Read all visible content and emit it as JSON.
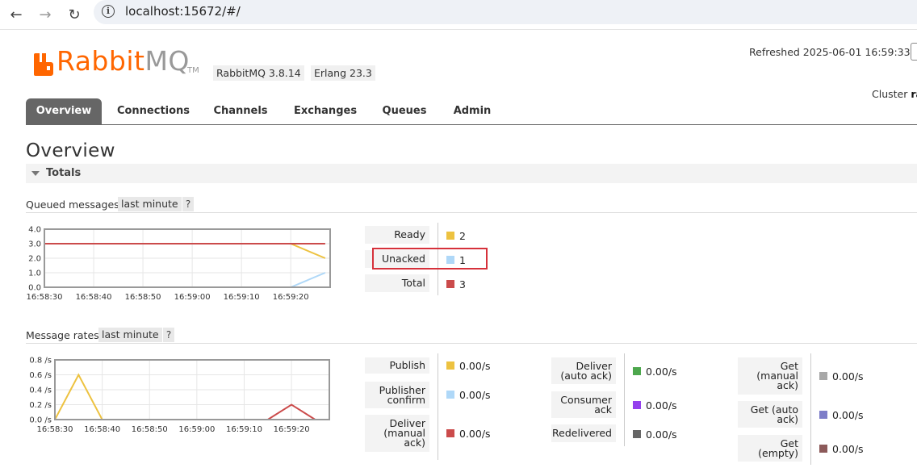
{
  "browser": {
    "url": "localhost:15672/#/",
    "back_icon": "arrow-left-icon",
    "forward_icon": "arrow-right-icon",
    "reload_icon": "reload-icon",
    "info_icon": "info-icon",
    "info_glyph": "i"
  },
  "header": {
    "logo_rabbit": "Rabbit",
    "logo_mq": "MQ",
    "logo_tm": "TM",
    "version_rabbitmq": "RabbitMQ 3.8.14",
    "version_erlang": "Erlang 23.3",
    "refreshed": "Refreshed 2025-06-01 16:59:33",
    "cluster_label": "Cluster",
    "cluster_value": "ra"
  },
  "tabs": [
    {
      "label": "Overview",
      "active": true
    },
    {
      "label": "Connections"
    },
    {
      "label": "Channels"
    },
    {
      "label": "Exchanges"
    },
    {
      "label": "Queues"
    },
    {
      "label": "Admin"
    }
  ],
  "page_title": "Overview",
  "totals_label": "Totals",
  "queued": {
    "label": "Queued messages",
    "range": "last minute",
    "help": "?",
    "rows": [
      {
        "label": "Ready",
        "value": "2",
        "color": "#edc240"
      },
      {
        "label": "Unacked",
        "value": "1",
        "color": "#afd8f8"
      },
      {
        "label": "Total",
        "value": "3",
        "color": "#cb4b4b"
      }
    ]
  },
  "rates": {
    "label": "Message rates",
    "range": "last minute",
    "help": "?",
    "col1": [
      {
        "label": "Publish",
        "value": "0.00/s",
        "color": "#edc240"
      },
      {
        "label": "Publisher confirm",
        "value": "0.00/s",
        "color": "#afd8f8"
      },
      {
        "label": "Deliver (manual ack)",
        "value": "0.00/s",
        "color": "#cb4b4b"
      }
    ],
    "col2": [
      {
        "label": "Deliver (auto ack)",
        "value": "0.00/s",
        "color": "#4da74d"
      },
      {
        "label": "Consumer ack",
        "value": "0.00/s",
        "color": "#9440ed"
      },
      {
        "label": "Redelivered",
        "value": "0.00/s",
        "color": "#666666"
      }
    ],
    "col3": [
      {
        "label": "Get (manual ack)",
        "value": "0.00/s",
        "color": "#a8a8a8"
      },
      {
        "label": "Get (auto ack)",
        "value": "0.00/s",
        "color": "#7d7dc8"
      },
      {
        "label": "Get (empty)",
        "value": "0.00/s",
        "color": "#8c5a5a"
      }
    ]
  },
  "chart_data": [
    {
      "type": "line",
      "x": [
        "16:58:30",
        "16:58:40",
        "16:58:50",
        "16:59:00",
        "16:59:10",
        "16:59:20",
        "16:59:27"
      ],
      "x_ticks": [
        "16:58:30",
        "16:58:40",
        "16:58:50",
        "16:59:00",
        "16:59:10",
        "16:59:20"
      ],
      "y_ticks": [
        "0.0",
        "1.0",
        "2.0",
        "3.0",
        "4.0"
      ],
      "ylim": [
        0,
        4
      ],
      "grid": true,
      "series": [
        {
          "values": [
            3,
            3,
            3,
            3,
            3,
            3,
            2
          ],
          "color": "#edc240"
        },
        {
          "values": [
            0,
            0,
            0,
            0,
            0,
            0,
            1
          ],
          "color": "#afd8f8"
        },
        {
          "values": [
            3,
            3,
            3,
            3,
            3,
            3,
            3
          ],
          "color": "#cb4b4b"
        }
      ]
    },
    {
      "type": "line",
      "x": [
        "16:58:30",
        "16:58:35",
        "16:58:40",
        "16:59:10",
        "16:59:15",
        "16:59:20",
        "16:59:25"
      ],
      "x_ticks": [
        "16:58:30",
        "16:58:40",
        "16:58:50",
        "16:59:00",
        "16:59:10",
        "16:59:20"
      ],
      "y_ticks": [
        "0.0 /s",
        "0.2 /s",
        "0.4 /s",
        "0.6 /s",
        "0.8 /s"
      ],
      "ylim": [
        0,
        0.8
      ],
      "grid": true,
      "series": [
        {
          "values": [
            0,
            0.6,
            0,
            0,
            0,
            0,
            0
          ],
          "color": "#edc240"
        },
        {
          "values": [
            0,
            0,
            0,
            0,
            0,
            0.2,
            0
          ],
          "color": "#cb4b4b"
        }
      ]
    }
  ]
}
